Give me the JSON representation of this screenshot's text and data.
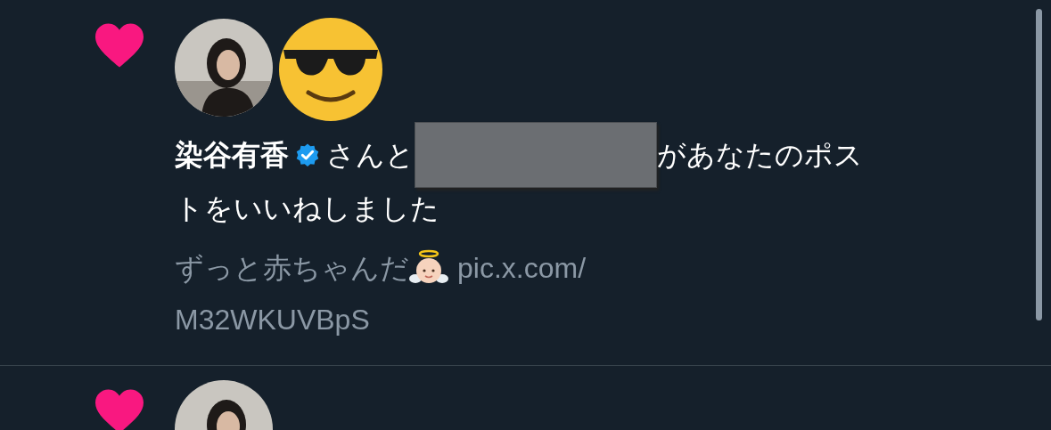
{
  "notifications": [
    {
      "kind": "like",
      "name": "染谷有香",
      "verified": true,
      "text_before": "さんと",
      "redacted": true,
      "text_after_lines": [
        "があなたのポス",
        "トをいいねしました"
      ],
      "post_text": "ずっと赤ちゃんだ",
      "post_link_lines": [
        "pic.x.com/",
        "M32WKUVBpS"
      ]
    },
    {
      "kind": "like"
    }
  ]
}
